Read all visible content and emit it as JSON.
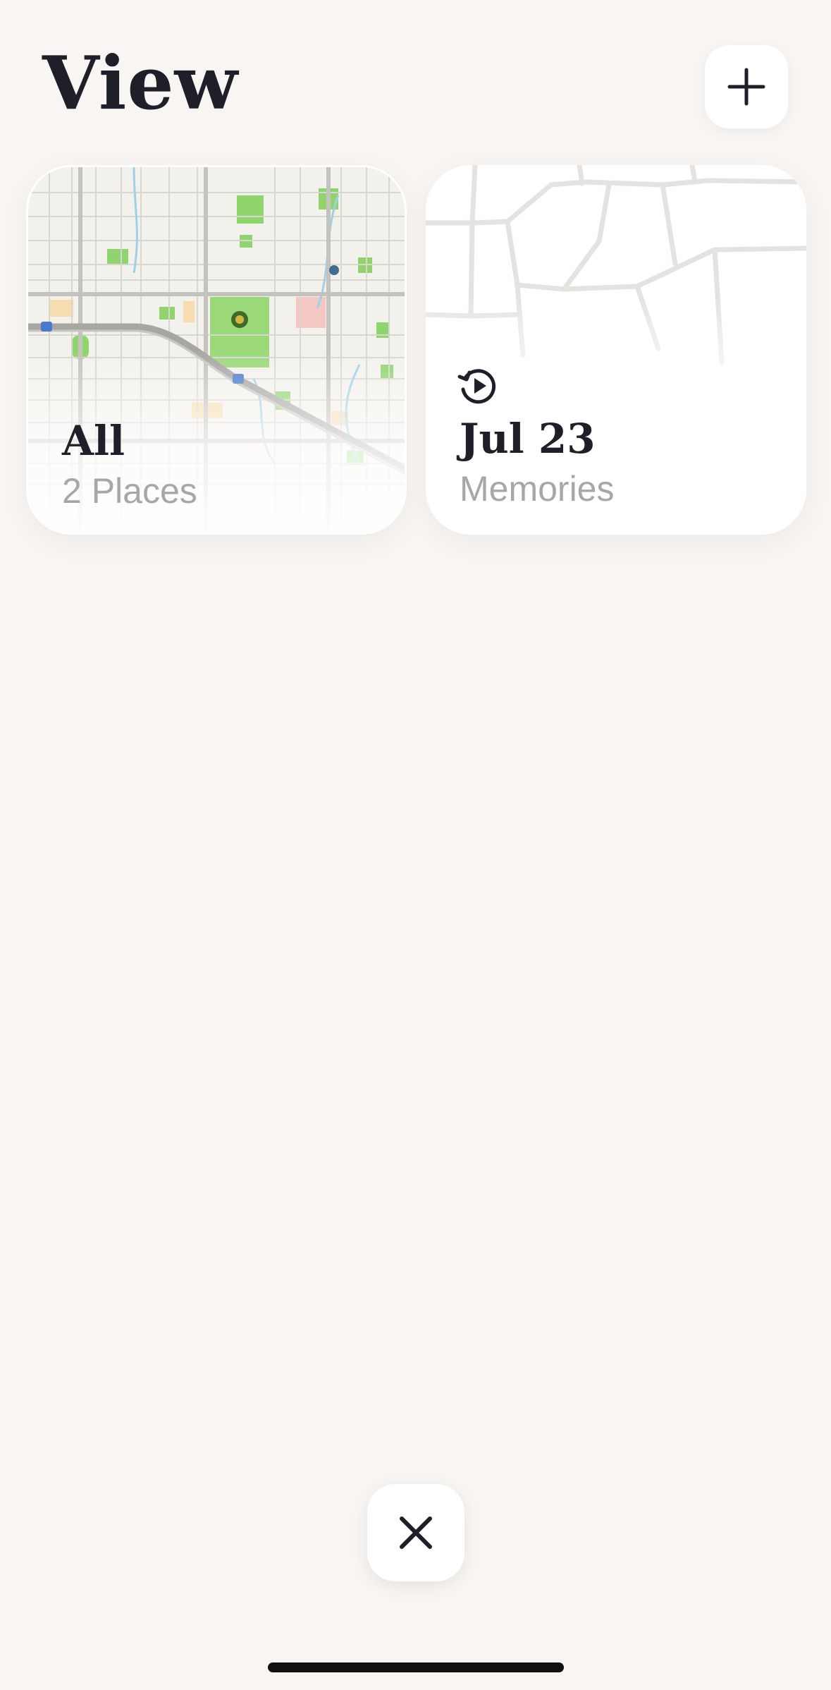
{
  "header": {
    "title": "View",
    "add_icon": "plus-icon"
  },
  "cards": [
    {
      "title": "All",
      "subtitle": "2 Places",
      "background": "street-map"
    },
    {
      "title": "Jul 23",
      "subtitle": "Memories",
      "icon": "replay-memory-icon",
      "background": "faded-street-map"
    }
  ],
  "footer": {
    "close_icon": "close-icon"
  },
  "colors": {
    "background": "#f8f5f2",
    "text_primary": "#1f1f2a",
    "text_secondary": "#a9a6a6",
    "park_green": "#8fd46c",
    "card": "#ffffff"
  }
}
